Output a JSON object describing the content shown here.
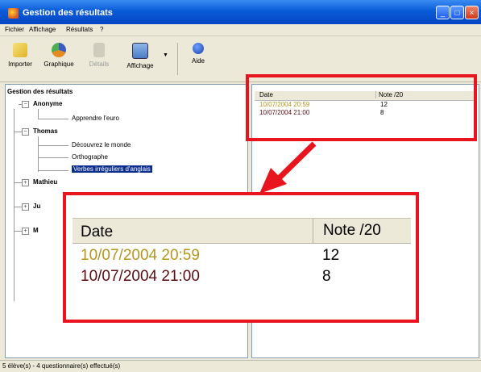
{
  "window": {
    "title": "Gestion des résultats",
    "controls": [
      "_",
      "□",
      "×"
    ]
  },
  "menu": [
    "Fichier",
    "Affichage",
    "Résultats",
    "?"
  ],
  "toolbar": [
    {
      "label": "Importer",
      "icon": "import-icon",
      "enabled": true
    },
    {
      "label": "Graphique",
      "icon": "chart-icon",
      "enabled": true
    },
    {
      "label": "Détails",
      "icon": "details-icon",
      "enabled": false
    },
    {
      "label": "Affichage",
      "icon": "view-icon",
      "enabled": true
    },
    {
      "label": "Aide",
      "icon": "help-icon",
      "enabled": true
    }
  ],
  "tree": {
    "root": "Gestion des résultats",
    "nodes": [
      {
        "label": "Anonyme",
        "bold": true
      },
      {
        "label": "Apprendre l'euro",
        "bold": false
      },
      {
        "label": "Thomas",
        "bold": true
      },
      {
        "label": "Découvrez le monde",
        "bold": false
      },
      {
        "label": "Orthographe",
        "bold": false
      },
      {
        "label": "Verbes irréguliers d'anglais",
        "bold": false,
        "selected": true
      },
      {
        "label": "Mathieu",
        "bold": true
      },
      {
        "label": "Ju",
        "bold": true
      },
      {
        "label": "M",
        "bold": true
      }
    ]
  },
  "results": {
    "headers": [
      "Date",
      "Note /20"
    ],
    "rows": [
      {
        "date": "10/07/2004 20:59",
        "note": "12",
        "color": "#b5951e"
      },
      {
        "date": "10/07/2004 21:00",
        "note": "8",
        "color": "#5a0c12"
      }
    ]
  },
  "status": "5 élève(s) - 4 questionnaire(s) effectué(s)",
  "colors": {
    "highlight": "#e8141e",
    "selection": "#0a2c8c"
  }
}
